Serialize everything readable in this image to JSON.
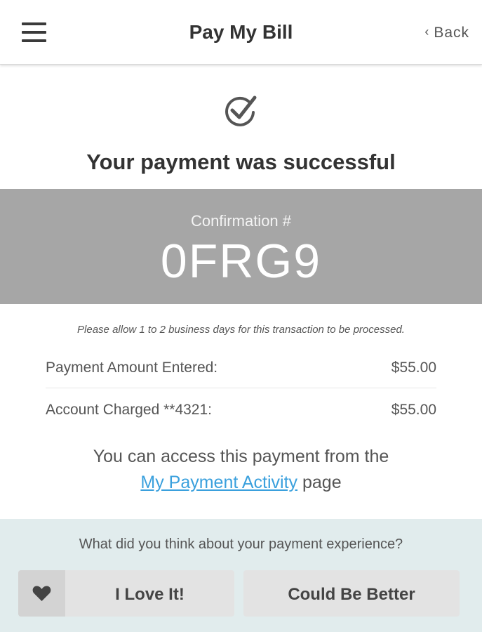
{
  "header": {
    "title": "Pay My Bill",
    "back_chevron": "‹",
    "back_label": "Back"
  },
  "status": {
    "icon": "check-circle-icon",
    "message": "Your payment was successful"
  },
  "confirmation": {
    "label": "Confirmation #",
    "number": "0FRG9"
  },
  "notice": "Please allow 1 to 2 business days for this transaction to be processed.",
  "details": [
    {
      "label": "Payment Amount Entered:",
      "value": "$55.00"
    },
    {
      "label": "Account Charged **4321:",
      "value": "$55.00"
    }
  ],
  "access": {
    "line1": "You can access this payment from the",
    "link": "My Payment Activity",
    "suffix": "page"
  },
  "feedback": {
    "question": "What did you think about your payment experience?",
    "love_label": "I Love It!",
    "better_label": "Could Be Better"
  },
  "colors": {
    "confirm_band": "#a6a6a6",
    "link": "#3aa0dd",
    "feedback_bg": "#e1eced",
    "button_bg": "#e3e3e3"
  }
}
